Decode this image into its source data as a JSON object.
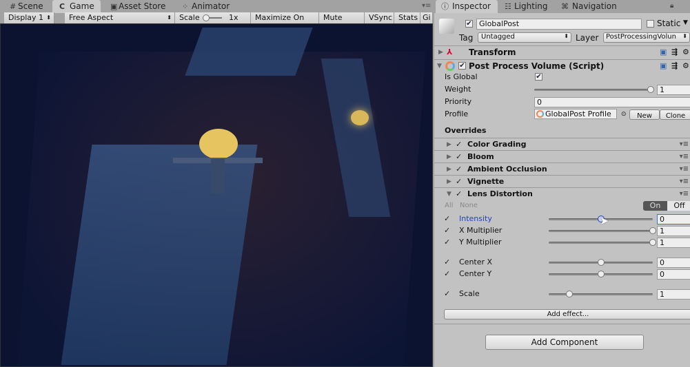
{
  "scene_tabs": [
    {
      "label": "Scene",
      "icon": "hash-icon"
    },
    {
      "label": "Game",
      "icon": "pacman-icon",
      "active": true
    },
    {
      "label": "Asset Store",
      "icon": "bag-icon"
    },
    {
      "label": "Animator",
      "icon": "nodes-icon"
    }
  ],
  "game_toolbar": {
    "display": "Display 1",
    "aspect": "Free Aspect",
    "scale_label": "Scale",
    "scale_value": "1x",
    "maximize": "Maximize On Play",
    "mute": "Mute Audio",
    "vsync": "VSync",
    "stats": "Stats",
    "gizmos": "Gi"
  },
  "inspector_tabs": [
    {
      "label": "Inspector",
      "icon": "info-icon",
      "active": true
    },
    {
      "label": "Lighting",
      "icon": "lighting-icon"
    },
    {
      "label": "Navigation",
      "icon": "navigation-icon"
    }
  ],
  "object": {
    "name": "GlobalPost",
    "active": true,
    "static_label": "Static",
    "tag_label": "Tag",
    "tag": "Untagged",
    "layer_label": "Layer",
    "layer": "PostProcessingVolun"
  },
  "transform": {
    "title": "Transform"
  },
  "ppv": {
    "title": "Post Process Volume (Script)",
    "is_global_label": "Is Global",
    "is_global": true,
    "weight_label": "Weight",
    "weight": "1",
    "weight_fraction": 1.0,
    "priority_label": "Priority",
    "priority": "0",
    "profile_label": "Profile",
    "profile": "GlobalPost Profile",
    "new_label": "New",
    "clone_label": "Clone"
  },
  "overrides": {
    "title": "Overrides",
    "effects": [
      {
        "name": "Color Grading"
      },
      {
        "name": "Bloom"
      },
      {
        "name": "Ambient Occlusion"
      },
      {
        "name": "Vignette"
      },
      {
        "name": "Lens Distortion",
        "expanded": true
      }
    ],
    "all_label": "All",
    "none_label": "None",
    "on_label": "On",
    "off_label": "Off",
    "params": [
      {
        "label": "Intensity",
        "value": "0",
        "fraction": 0.5,
        "active": true
      },
      {
        "label": "X Multiplier",
        "value": "1",
        "fraction": 1.0
      },
      {
        "label": "Y Multiplier",
        "value": "1",
        "fraction": 1.0
      },
      {
        "label": "Center X",
        "value": "0",
        "fraction": 0.5
      },
      {
        "label": "Center Y",
        "value": "0",
        "fraction": 0.5
      },
      {
        "label": "Scale",
        "value": "1",
        "fraction": 0.2
      }
    ],
    "add_effect": "Add effect..."
  },
  "add_component": "Add Component"
}
